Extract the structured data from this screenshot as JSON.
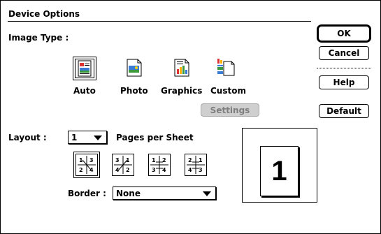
{
  "dialog": {
    "title": "Device Options",
    "image_type_label": "Image Type :",
    "image_types": [
      {
        "label": "Auto",
        "icon": "auto-icon",
        "selected": true
      },
      {
        "label": "Photo",
        "icon": "photo-icon",
        "selected": false
      },
      {
        "label": "Graphics",
        "icon": "graphics-icon",
        "selected": false
      },
      {
        "label": "Custom",
        "icon": "custom-icon",
        "selected": false
      }
    ],
    "settings_label": "Settings",
    "layout_label": "Layout :",
    "layout_value": "1",
    "pages_per_sheet_label": "Pages per Sheet",
    "layout_orders": [
      {
        "icon": "layout-order-1-icon",
        "selected": true
      },
      {
        "icon": "layout-order-2-icon",
        "selected": false
      },
      {
        "icon": "layout-order-3-icon",
        "selected": false
      },
      {
        "icon": "layout-order-4-icon",
        "selected": false
      }
    ],
    "border_label": "Border :",
    "border_value": "None",
    "preview_page_number": "1"
  },
  "buttons": {
    "ok": "OK",
    "cancel": "Cancel",
    "help": "Help",
    "default": "Default"
  }
}
